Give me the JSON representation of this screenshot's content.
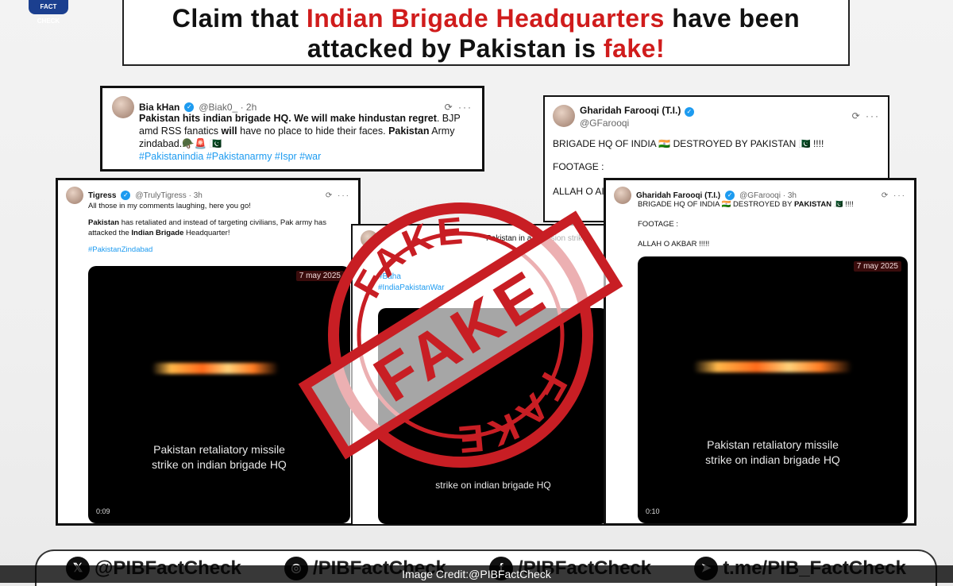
{
  "headline": {
    "part1": "Claim that ",
    "highlight1": "Indian Brigade Headquarters",
    "part2": " have been attacked by Pakistan is ",
    "highlight2": "fake!"
  },
  "tweets": [
    {
      "name": "Bia kHan",
      "handle": "@Biak0_ · 2h",
      "line1_bold": "Pakistan hits indian brigade HQ. We will make hindustan regret",
      "line1_rest": ". BJP",
      "line2_a": "amd RSS fanatics ",
      "line2_bold": "will",
      "line2_b": " have no place to hide their faces. ",
      "line2_bold2": "Pakistan",
      "line2_c": " Army",
      "line3": "zindabad.🪖🚨 🇵🇰",
      "tags": "#Pakistanindia #Pakistanarmy #Ispr #war"
    },
    {
      "name": "Gharidah Farooqi (T.I.)",
      "handle": "@GFarooqi",
      "line1": "BRIGADE HQ OF INDIA 🇮🇳 DESTROYED BY PAKISTAN 🇵🇰 !!!!",
      "line2": "FOOTAGE :",
      "line3": "ALLAH O AI"
    },
    {
      "name": "Tigress",
      "handle": "@TrulyTigress · 3h",
      "line1": "All those in my comments laughing, here you go!",
      "line2_bold": "Pakistan",
      "line2_rest": " has retaliated and instead of targeting civilians, Pak army has",
      "line3_a": "attacked the ",
      "line3_bold": "Indian Brigade",
      "line3_b": " Headquarter!",
      "tags": "#PakistanZindabad",
      "video_date": "7 may 2025",
      "video_caption1": "Pakistan retaliatory missile",
      "video_caption2": "strike on indian brigade HQ",
      "video_time": "0:09"
    },
    {
      "line1": "Pakistan in a precision strike",
      "tag1": "#Baha",
      "tag2": "#IndiaPakistanWar",
      "video_caption": "strike on indian brigade HQ"
    },
    {
      "name": "Gharidah Farooqi (T.I.)",
      "handle": "@GFarooqi · 3h",
      "line1_a": "BRIGADE HQ OF INDIA 🇮🇳 DESTROYED BY ",
      "line1_bold": "PAKISTAN",
      "line1_b": " 🇵🇰 !!!!",
      "line2": "FOOTAGE :",
      "line3": "ALLAH O AKBAR !!!!!",
      "video_date": "7 may 2025",
      "video_caption1": "Pakistan retaliatory missile",
      "video_caption2": "strike on indian brigade HQ",
      "video_time": "0:10"
    }
  ],
  "stamp": {
    "text": "FAKE",
    "color": "#c81e24"
  },
  "social": [
    {
      "icon": "x-icon",
      "glyph": "𝕏",
      "label": "@PIBFactCheck"
    },
    {
      "icon": "instagram-threads-icon",
      "glyph": "◎",
      "label": "/PIBFactCheck"
    },
    {
      "icon": "facebook-icon",
      "glyph": "f",
      "label": "/PIBFactCheck"
    },
    {
      "icon": "telegram-icon",
      "glyph": "➤",
      "label": "t.me/PIB_FactCheck"
    }
  ],
  "credit": "Image Credit:@PIBFactCheck",
  "logo_text": "FACT CHECK"
}
